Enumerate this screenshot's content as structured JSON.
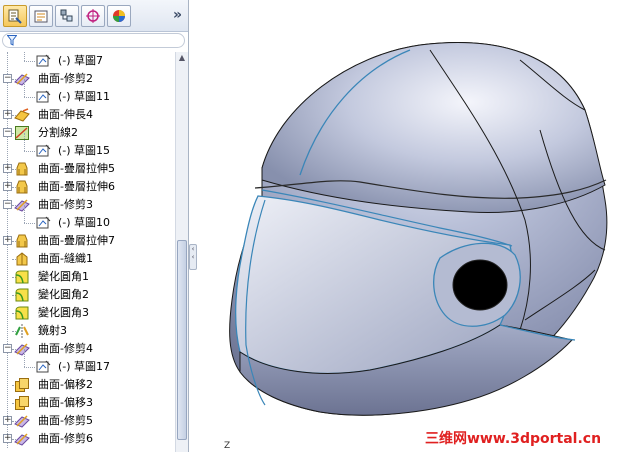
{
  "panel": {
    "tabs": [
      {
        "name": "feature-manager-tab-icon",
        "active": true
      },
      {
        "name": "property-manager-tab-icon"
      },
      {
        "name": "configuration-manager-tab-icon"
      },
      {
        "name": "dimxpert-tab-icon"
      },
      {
        "name": "display-manager-tab-icon"
      }
    ],
    "expand_label": "»",
    "filter_icon": "filter-icon"
  },
  "tree": {
    "items": [
      {
        "label": "(-) 草圖7",
        "icon": "sketch-icon",
        "level": 2,
        "expander": ""
      },
      {
        "label": "曲面-修剪2",
        "icon": "surface-trim-icon",
        "level": 1,
        "expander": "-"
      },
      {
        "label": "(-) 草圖11",
        "icon": "sketch-icon",
        "level": 2,
        "expander": ""
      },
      {
        "label": "曲面-伸長4",
        "icon": "surface-extend-icon",
        "level": 1,
        "expander": "+"
      },
      {
        "label": "分割線2",
        "icon": "split-line-icon",
        "level": 1,
        "expander": "-"
      },
      {
        "label": "(-) 草圖15",
        "icon": "sketch-icon",
        "level": 2,
        "expander": ""
      },
      {
        "label": "曲面-疊層拉伸5",
        "icon": "surface-loft-icon",
        "level": 1,
        "expander": "+"
      },
      {
        "label": "曲面-疊層拉伸6",
        "icon": "surface-loft-icon",
        "level": 1,
        "expander": "+"
      },
      {
        "label": "曲面-修剪3",
        "icon": "surface-trim-icon",
        "level": 1,
        "expander": "-"
      },
      {
        "label": "(-) 草圖10",
        "icon": "sketch-icon",
        "level": 2,
        "expander": ""
      },
      {
        "label": "曲面-疊層拉伸7",
        "icon": "surface-loft-icon",
        "level": 1,
        "expander": "+"
      },
      {
        "label": "曲面-縫織1",
        "icon": "surface-knit-icon",
        "level": 1,
        "expander": ""
      },
      {
        "label": "變化圓角1",
        "icon": "variable-fillet-icon",
        "level": 1,
        "expander": ""
      },
      {
        "label": "變化圓角2",
        "icon": "variable-fillet-icon",
        "level": 1,
        "expander": ""
      },
      {
        "label": "變化圓角3",
        "icon": "variable-fillet-icon",
        "level": 1,
        "expander": ""
      },
      {
        "label": "鏡射3",
        "icon": "mirror-icon",
        "level": 1,
        "expander": ""
      },
      {
        "label": "曲面-修剪4",
        "icon": "surface-trim-icon",
        "level": 1,
        "expander": "-"
      },
      {
        "label": "(-) 草圖17",
        "icon": "sketch-icon",
        "level": 2,
        "expander": ""
      },
      {
        "label": "曲面-偏移2",
        "icon": "surface-offset-icon",
        "level": 1,
        "expander": ""
      },
      {
        "label": "曲面-偏移3",
        "icon": "surface-offset-icon",
        "level": 1,
        "expander": ""
      },
      {
        "label": "曲面-修剪5",
        "icon": "surface-trim-icon",
        "level": 1,
        "expander": "+"
      },
      {
        "label": "曲面-修剪6",
        "icon": "surface-trim-icon",
        "level": 1,
        "expander": "+"
      }
    ]
  },
  "viewport": {
    "model": "helmet-model",
    "triad_label": "Z",
    "watermark": "三维网www.3dportal.cn"
  },
  "colors": {
    "helmet_base": "#9ba3c0",
    "helmet_highlight": "#e6e9f4",
    "edge_blue": "#3a86b8",
    "edge_black": "#1a1a1a",
    "watermark": "#e02020"
  }
}
